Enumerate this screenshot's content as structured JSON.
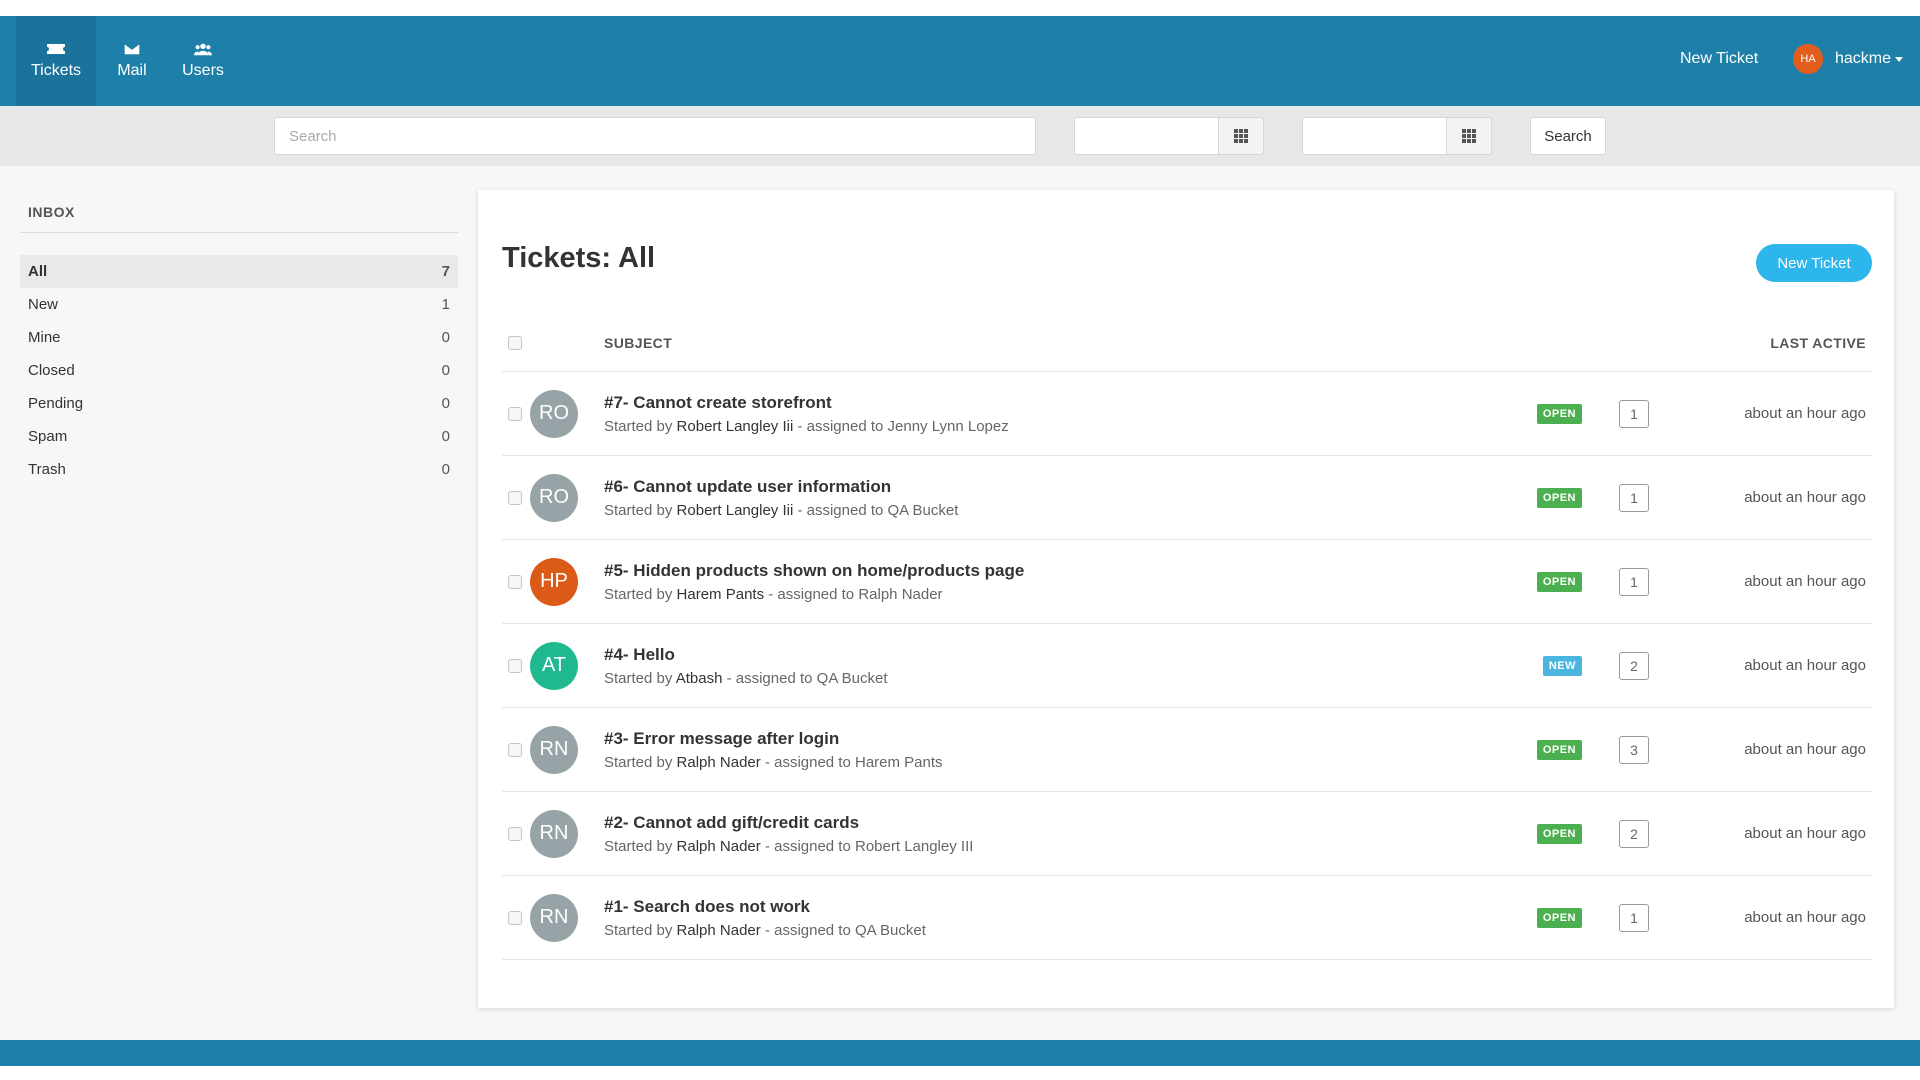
{
  "nav": {
    "items": [
      {
        "label": "Tickets",
        "icon": "ticket-icon",
        "active": true
      },
      {
        "label": "Mail",
        "icon": "envelope-icon",
        "active": false
      },
      {
        "label": "Users",
        "icon": "users-icon",
        "active": false
      }
    ],
    "new_ticket": "New Ticket",
    "user": {
      "initials": "HA",
      "name": "hackme"
    }
  },
  "search": {
    "placeholder": "Search",
    "date_from": "",
    "date_to": "",
    "button": "Search"
  },
  "sidebar": {
    "title": "INBOX",
    "items": [
      {
        "label": "All",
        "count": "7",
        "active": true
      },
      {
        "label": "New",
        "count": "1"
      },
      {
        "label": "Mine",
        "count": "0"
      },
      {
        "label": "Closed",
        "count": "0"
      },
      {
        "label": "Pending",
        "count": "0"
      },
      {
        "label": "Spam",
        "count": "0"
      },
      {
        "label": "Trash",
        "count": "0"
      }
    ]
  },
  "main": {
    "title": "Tickets: All",
    "new_ticket_button": "New Ticket",
    "columns": {
      "subject": "SUBJECT",
      "last_active": "LAST ACTIVE"
    },
    "meta_started": "Started by",
    "meta_assigned": "- assigned to",
    "tickets": [
      {
        "initials": "RO",
        "avatar_color": "#97a3a6",
        "title": "#7- Cannot create storefront",
        "started_by": "Robert Langley Iii",
        "assigned_to": "Jenny Lynn Lopez",
        "status": "OPEN",
        "status_color": "#4caf50",
        "count": "1",
        "last_active": "about an hour ago"
      },
      {
        "initials": "RO",
        "avatar_color": "#97a3a6",
        "title": "#6- Cannot update user information",
        "started_by": "Robert Langley Iii",
        "assigned_to": "QA Bucket",
        "status": "OPEN",
        "status_color": "#4caf50",
        "count": "1",
        "last_active": "about an hour ago"
      },
      {
        "initials": "HP",
        "avatar_color": "#dc5a18",
        "title": "#5- Hidden products shown on home/products page",
        "started_by": "Harem Pants",
        "assigned_to": "Ralph Nader",
        "status": "OPEN",
        "status_color": "#4caf50",
        "count": "1",
        "last_active": "about an hour ago"
      },
      {
        "initials": "AT",
        "avatar_color": "#1fb88f",
        "title": "#4- Hello",
        "started_by": "Atbash",
        "assigned_to": "QA Bucket",
        "status": "NEW",
        "status_color": "#4ab6e0",
        "count": "2",
        "last_active": "about an hour ago"
      },
      {
        "initials": "RN",
        "avatar_color": "#97a3a6",
        "title": "#3- Error message after login",
        "started_by": "Ralph Nader",
        "assigned_to": "Harem Pants",
        "status": "OPEN",
        "status_color": "#4caf50",
        "count": "3",
        "last_active": "about an hour ago"
      },
      {
        "initials": "RN",
        "avatar_color": "#97a3a6",
        "title": "#2- Cannot add gift/credit cards",
        "started_by": "Ralph Nader",
        "assigned_to": "Robert Langley III",
        "status": "OPEN",
        "status_color": "#4caf50",
        "count": "2",
        "last_active": "about an hour ago"
      },
      {
        "initials": "RN",
        "avatar_color": "#97a3a6",
        "title": "#1- Search does not work",
        "started_by": "Ralph Nader",
        "assigned_to": "QA Bucket",
        "status": "OPEN",
        "status_color": "#4caf50",
        "count": "1",
        "last_active": "about an hour ago"
      }
    ]
  },
  "colors": {
    "brand": "#1e80a8",
    "accent": "#2db6ec"
  }
}
